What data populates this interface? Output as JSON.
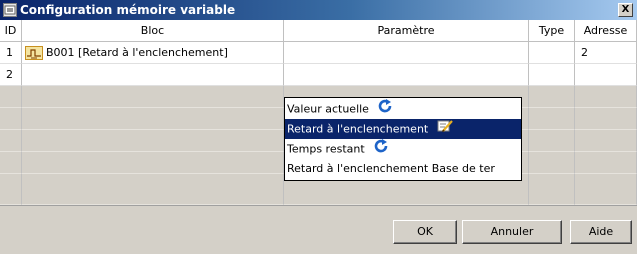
{
  "window": {
    "title": "Configuration mémoire variable",
    "close_label": "X"
  },
  "table": {
    "columns": [
      "ID",
      "Bloc",
      "Paramètre",
      "Type",
      "Adresse"
    ],
    "rows": [
      {
        "id": "1",
        "bloc": "B001 [Retard à l'enclenchement]",
        "parametre": "",
        "type": "",
        "adresse": "2"
      },
      {
        "id": "2",
        "bloc": "",
        "parametre": "",
        "type": "",
        "adresse": ""
      }
    ]
  },
  "dropdown": {
    "options": [
      {
        "label": "Valeur actuelle",
        "icon": "refresh-icon",
        "selected": false
      },
      {
        "label": "Retard à l'enclenchement",
        "icon": "edit-icon",
        "selected": true
      },
      {
        "label": "Temps restant",
        "icon": "refresh-icon",
        "selected": false
      },
      {
        "label": "Retard à l'enclenchement Base de ter",
        "icon": "",
        "selected": false
      }
    ]
  },
  "buttons": {
    "ok": "OK",
    "cancel": "Annuler",
    "help": "Aide"
  },
  "colors": {
    "titlebar_start": "#0a246a",
    "titlebar_end": "#a6caf0",
    "selection": "#0a246a",
    "window_bg": "#d4d0c8"
  }
}
